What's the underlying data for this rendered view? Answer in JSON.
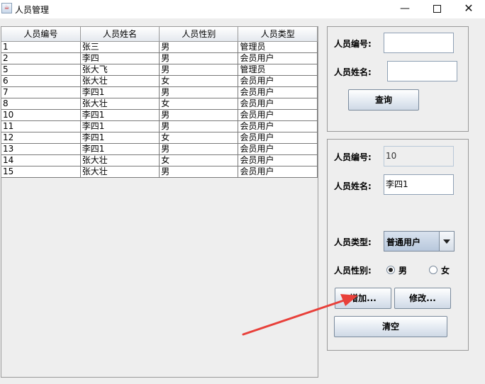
{
  "window": {
    "title": "人员管理",
    "icon": "java-cup-icon",
    "controls": {
      "minimize": "—",
      "close": "✕"
    }
  },
  "table": {
    "columns": [
      "人员编号",
      "人员姓名",
      "人员性别",
      "人员类型"
    ],
    "rows": [
      [
        "1",
        "张三",
        "男",
        "管理员"
      ],
      [
        "2",
        "李四",
        "男",
        "会员用户"
      ],
      [
        "5",
        "张大飞",
        "男",
        "管理员"
      ],
      [
        "6",
        "张大壮",
        "女",
        "会员用户"
      ],
      [
        "7",
        "李四1",
        "男",
        "会员用户"
      ],
      [
        "8",
        "张大壮",
        "女",
        "会员用户"
      ],
      [
        "10",
        "李四1",
        "男",
        "会员用户"
      ],
      [
        "11",
        "李四1",
        "男",
        "会员用户"
      ],
      [
        "12",
        "李四1",
        "女",
        "会员用户"
      ],
      [
        "13",
        "李四1",
        "男",
        "会员用户"
      ],
      [
        "14",
        "张大壮",
        "女",
        "会员用户"
      ],
      [
        "15",
        "张大壮",
        "男",
        "会员用户"
      ]
    ]
  },
  "search": {
    "id_label": "人员编号:",
    "id_value": "",
    "name_label": "人员姓名:",
    "name_value": "",
    "query_button": "查询"
  },
  "edit": {
    "id_label": "人员编号:",
    "id_value": "10",
    "name_label": "人员姓名:",
    "name_value": "李四1",
    "type_label": "人员类型:",
    "type_value": "普通用户",
    "gender_label": "人员性别:",
    "gender_options": [
      "男",
      "女"
    ],
    "gender_selected": "男",
    "add_button": "增加...",
    "modify_button": "修改...",
    "clear_button": "清空"
  },
  "colors": {
    "annotation_arrow": "#e8403a"
  }
}
